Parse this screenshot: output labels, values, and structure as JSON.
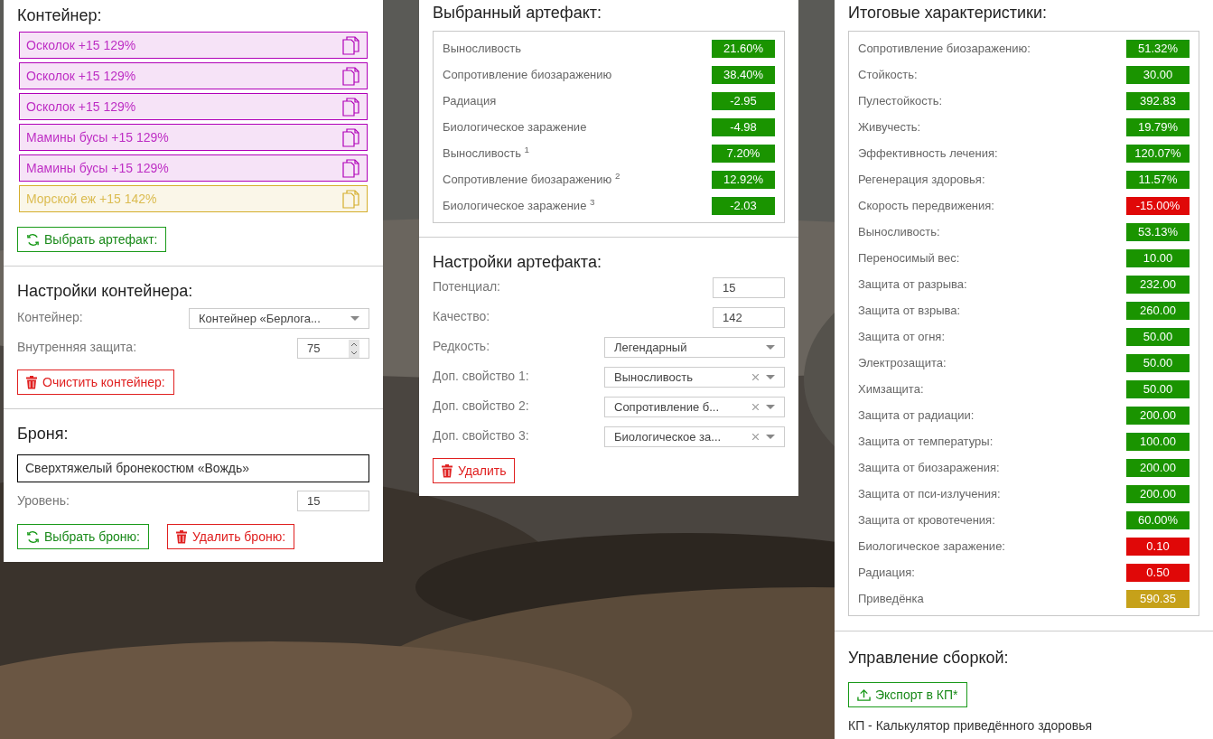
{
  "container": {
    "title": "Контейнер:",
    "slots": [
      {
        "label": "Осколок +15 129%",
        "color": "#b000b8"
      },
      {
        "label": "Осколок +15 129%",
        "color": "#b000b8"
      },
      {
        "label": "Осколок +15 129%",
        "color": "#b000b8"
      },
      {
        "label": "Мамины бусы +15 129%",
        "color": "#b000b8"
      },
      {
        "label": "Мамины бусы +15 129%",
        "color": "#b000b8"
      },
      {
        "label": "Морской еж +15 142%",
        "color": "#d4ae2c"
      }
    ],
    "pick_button": "Выбрать артефакт:"
  },
  "container_settings": {
    "title": "Настройки контейнера:",
    "fields": [
      {
        "label": "Контейнер:",
        "kind": "select",
        "value": "Контейнер «Берлога..."
      },
      {
        "label": "Внутренняя защита:",
        "kind": "spinner",
        "value": "75"
      }
    ],
    "clear_button": "Очистить контейнер:"
  },
  "armor": {
    "title": "Броня:",
    "name": "Сверхтяжелый бронекостюм «Вождь»",
    "level_label": "Уровень:",
    "level_value": "15",
    "pick_button": "Выбрать броню:",
    "delete_button": "Удалить броню:"
  },
  "selected_artifact": {
    "title": "Выбранный артефакт:",
    "stats": [
      {
        "label": "Выносливость",
        "value": "21.60%",
        "color": "#1a9400"
      },
      {
        "label": "Сопротивление биозаражению",
        "value": "38.40%",
        "color": "#1a9400"
      },
      {
        "label": "Радиация",
        "value": "-2.95",
        "color": "#1a9400"
      },
      {
        "label": "Биологическое заражение",
        "value": "-4.98",
        "color": "#1a9400"
      },
      {
        "label": "Выносливость $^{1}$",
        "value": "7.20%",
        "color": "#1a9400"
      },
      {
        "label": "Сопротивление биозаражению $^{2}$",
        "value": "12.92%",
        "color": "#1a9400"
      },
      {
        "label": "Биологическое заражение $^{3}$",
        "value": "-2.03",
        "color": "#1a9400"
      }
    ]
  },
  "artifact_settings": {
    "title": "Настройки артефакта:",
    "fields": [
      {
        "label": "Потенциал:",
        "kind": "number",
        "value": "15"
      },
      {
        "label": "Качество:",
        "kind": "number",
        "value": "142"
      },
      {
        "label": "Редкость:",
        "kind": "select",
        "value": "Легендарный",
        "clearable": false
      },
      {
        "label": "Доп. свойство 1:",
        "kind": "select",
        "value": "Выносливость",
        "clearable": true
      },
      {
        "label": "Доп. свойство 2:",
        "kind": "select",
        "value": "Сопротивление б...",
        "clearable": true
      },
      {
        "label": "Доп. свойство 3:",
        "kind": "select",
        "value": "Биологическое за...",
        "clearable": true
      }
    ],
    "delete_button": "Удалить"
  },
  "totals": {
    "title": "Итоговые характеристики:",
    "stats": [
      {
        "label": "Сопротивление биозаражению:",
        "value": "51.32%",
        "color": "#1a9400"
      },
      {
        "label": "Стойкость:",
        "value": "30.00",
        "color": "#1a9400"
      },
      {
        "label": "Пулестойкость:",
        "value": "392.83",
        "color": "#1a9400"
      },
      {
        "label": "Живучесть:",
        "value": "19.79%",
        "color": "#1a9400"
      },
      {
        "label": "Эффективность лечения:",
        "value": "120.07%",
        "color": "#1a9400"
      },
      {
        "label": "Регенерация здоровья:",
        "value": "11.57%",
        "color": "#1a9400"
      },
      {
        "label": "Скорость передвижения:",
        "value": "-15.00%",
        "color": "#e00808"
      },
      {
        "label": "Выносливость:",
        "value": "53.13%",
        "color": "#1a9400"
      },
      {
        "label": "Переносимый вес:",
        "value": "10.00",
        "color": "#1a9400"
      },
      {
        "label": "Защита от разрыва:",
        "value": "232.00",
        "color": "#1a9400"
      },
      {
        "label": "Защита от взрыва:",
        "value": "260.00",
        "color": "#1a9400"
      },
      {
        "label": "Защита от огня:",
        "value": "50.00",
        "color": "#1a9400"
      },
      {
        "label": "Электрозащита:",
        "value": "50.00",
        "color": "#1a9400"
      },
      {
        "label": "Химзащита:",
        "value": "50.00",
        "color": "#1a9400"
      },
      {
        "label": "Защита от радиации:",
        "value": "200.00",
        "color": "#1a9400"
      },
      {
        "label": "Защита от температуры:",
        "value": "100.00",
        "color": "#1a9400"
      },
      {
        "label": "Защита от биозаражения:",
        "value": "200.00",
        "color": "#1a9400"
      },
      {
        "label": "Защита от пси-излучения:",
        "value": "200.00",
        "color": "#1a9400"
      },
      {
        "label": "Защита от кровотечения:",
        "value": "60.00%",
        "color": "#1a9400"
      },
      {
        "label": "Биологическое заражение:",
        "value": "0.10",
        "color": "#e00808"
      },
      {
        "label": "Радиация:",
        "value": "0.50",
        "color": "#e00808"
      },
      {
        "label": "Приведёнка",
        "value": "590.35",
        "color": "#c6a11a"
      }
    ]
  },
  "build": {
    "title": "Управление сборкой:",
    "export_button": "Экспорт в КП*",
    "note": "КП - Калькулятор приведённого здоровья"
  }
}
